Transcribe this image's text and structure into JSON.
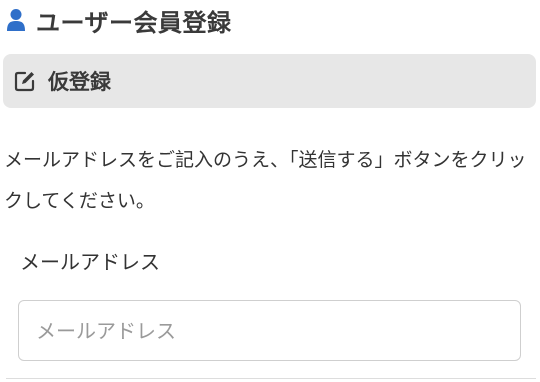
{
  "header": {
    "icon": "user-icon",
    "title": "ユーザー会員登録"
  },
  "section": {
    "icon": "edit-icon",
    "title": "仮登録"
  },
  "instructions": "メールアドレスをご記入のうえ、「送信する」ボタンをクリックしてください。",
  "form": {
    "email_label": "メールアドレス",
    "email_value": "",
    "email_placeholder": "メールアドレス"
  },
  "colors": {
    "icon_accent": "#2f6fc9",
    "section_bg": "#e7e7e7",
    "text": "#333333",
    "placeholder": "#9a9a9a"
  }
}
